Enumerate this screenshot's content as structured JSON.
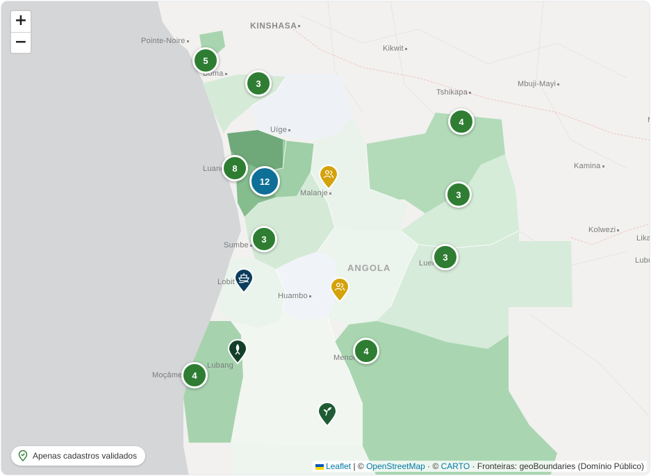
{
  "map": {
    "zoom_in_label": "+",
    "zoom_out_label": "−",
    "cities": {
      "kinshasa": "KINSHASA",
      "pointe_noire": "Pointe-Noire",
      "kikwit": "Kikwit",
      "boma": "Boma",
      "tshikapa": "Tshikapa",
      "mbuji_mayi": "Mbuji-Mayi",
      "uige": "Uíge",
      "luanda": "Luand",
      "kamina": "Kamina",
      "malanje": "Malanje",
      "kolwezi": "Kolwezi",
      "sumbe": "Sumbe",
      "likasi": "Lika",
      "lubumbashi": "Lubu",
      "angola": "ANGOLA",
      "luena": "Luen",
      "lobito": "Lobit",
      "huambo": "Huambo",
      "menongue": "Menon",
      "lubango": "Lubang",
      "mocamedes": "Moçâme",
      "edge_m": "M"
    },
    "clusters": [
      {
        "count": "5",
        "size": "normal"
      },
      {
        "count": "3",
        "size": "normal"
      },
      {
        "count": "4",
        "size": "normal"
      },
      {
        "count": "8",
        "size": "normal"
      },
      {
        "count": "12",
        "size": "large"
      },
      {
        "count": "3",
        "size": "normal"
      },
      {
        "count": "3",
        "size": "normal"
      },
      {
        "count": "3",
        "size": "normal"
      },
      {
        "count": "4",
        "size": "normal"
      },
      {
        "count": "4",
        "size": "normal"
      }
    ],
    "pins": [
      {
        "icon": "users-icon",
        "color": "#d4a20a"
      },
      {
        "icon": "users-icon",
        "color": "#d4a20a"
      },
      {
        "icon": "boat-icon",
        "color": "#0b3d5c"
      },
      {
        "icon": "fish-icon",
        "color": "#14402a"
      },
      {
        "icon": "sprout-icon",
        "color": "#1f5c33"
      }
    ],
    "colors": {
      "cluster": "#2e7d32",
      "cluster_large": "#0e6f97",
      "ocean": "#d4d6d8",
      "land": "#f2f1ef"
    }
  },
  "filter": {
    "label": "Apenas cadastros validados",
    "icon": "map-pin-check-icon"
  },
  "attribution": {
    "leaflet": "Leaflet",
    "sep1": " | © ",
    "osm": "OpenStreetMap",
    "sep2": " · © ",
    "carto": "CARTO",
    "rest": " · Fronteiras: geoBoundaries (Domínio Público)"
  }
}
